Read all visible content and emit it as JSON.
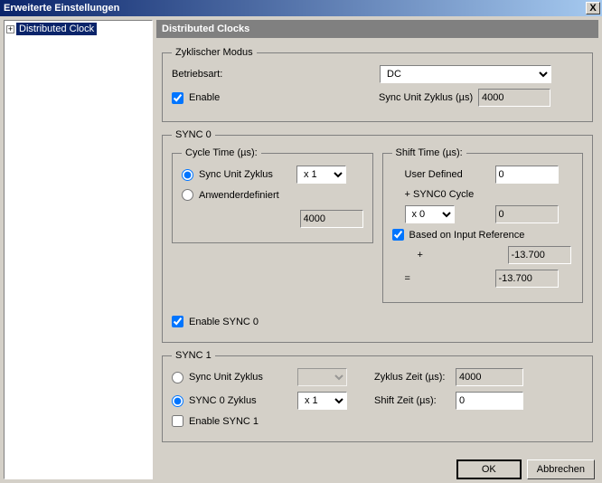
{
  "window": {
    "title": "Erweiterte Einstellungen",
    "close": "X"
  },
  "tree": {
    "expand": "+",
    "item": "Distributed Clock"
  },
  "header": "Distributed Clocks",
  "zModus": {
    "legend": "Zyklischer Modus",
    "betriebsart_label": "Betriebsart:",
    "betriebsart_value": "DC",
    "enable_label": "Enable",
    "syncUnit_label": "Sync Unit Zyklus (µs)",
    "syncUnit_value": "4000"
  },
  "sync0": {
    "legend": "SYNC 0",
    "cycle_legend": "Cycle Time (µs):",
    "radio_syncUnit": "Sync Unit Zyklus",
    "mult_value": "x 1",
    "radio_user": "Anwenderdefiniert",
    "cycle_value": "4000",
    "shift_legend": "Shift Time (µs):",
    "userDef_label": "User Defined",
    "userDef_value": "0",
    "sync0cycle_label": "+ SYNC0 Cycle",
    "sync0cycle_mult": "x 0",
    "sync0cycle_value": "0",
    "basedOn_label": "Based on Input Reference",
    "plus": "+",
    "plus_value": "-13.700",
    "eq": "=",
    "eq_value": "-13.700",
    "enable_label": "Enable SYNC 0"
  },
  "sync1": {
    "legend": "SYNC 1",
    "radio_syncUnit": "Sync Unit Zyklus",
    "radio_sync0": "SYNC 0 Zyklus",
    "mult_value": "x 1",
    "zyklus_label": "Zyklus Zeit (µs):",
    "zyklus_value": "4000",
    "shift_label": "Shift Zeit (µs):",
    "shift_value": "0",
    "enable_label": "Enable SYNC 1"
  },
  "buttons": {
    "ok": "OK",
    "cancel": "Abbrechen"
  }
}
